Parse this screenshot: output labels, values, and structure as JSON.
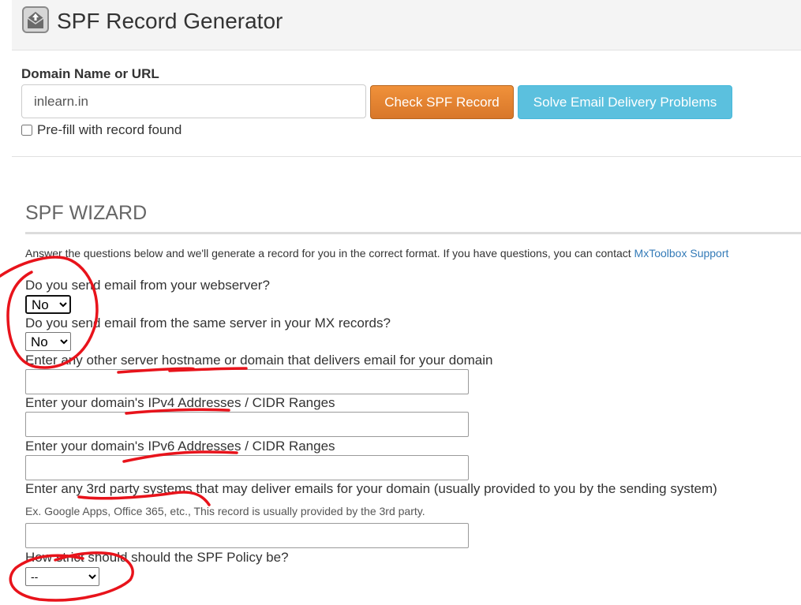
{
  "header": {
    "logo_icon": "envelope-upload-icon",
    "title": "SPF Record Generator"
  },
  "lookup": {
    "label": "Domain Name or URL",
    "domain_value": "inlearn.in",
    "check_button": "Check SPF Record",
    "solve_button": "Solve Email Delivery Problems",
    "prefill_label": "Pre-fill with record found",
    "prefill_checked": false
  },
  "wizard": {
    "title": "SPF WIZARD",
    "intro": "Answer the questions below and we'll generate a record for you in the correct format. If you have questions, you can contact ",
    "support_link": "MxToolbox Support",
    "q_webserver": "Do you send email from your webserver?",
    "q_webserver_value": "No",
    "q_mx": "Do you send email from the same server in your MX records?",
    "q_mx_value": "No",
    "q_hostname": "Enter any other server hostname or domain that delivers email for your domain",
    "q_hostname_value": "",
    "q_ipv4": "Enter your domain's IPv4 Addresses / CIDR Ranges",
    "q_ipv4_value": "",
    "q_ipv6": "Enter your domain's IPv6 Addresses / CIDR Ranges",
    "q_ipv6_value": "",
    "q_thirdparty": "Enter any 3rd party systems that may deliver emails for your domain (usually provided to you by the sending system)",
    "thirdparty_hint": "Ex. Google Apps, Office 365, etc., This record is usually provided by the 3rd party.",
    "q_thirdparty_value": "",
    "q_policy": "How strict should should the SPF Policy be?",
    "q_policy_value": "--"
  },
  "annotation_color": "#e8131b"
}
